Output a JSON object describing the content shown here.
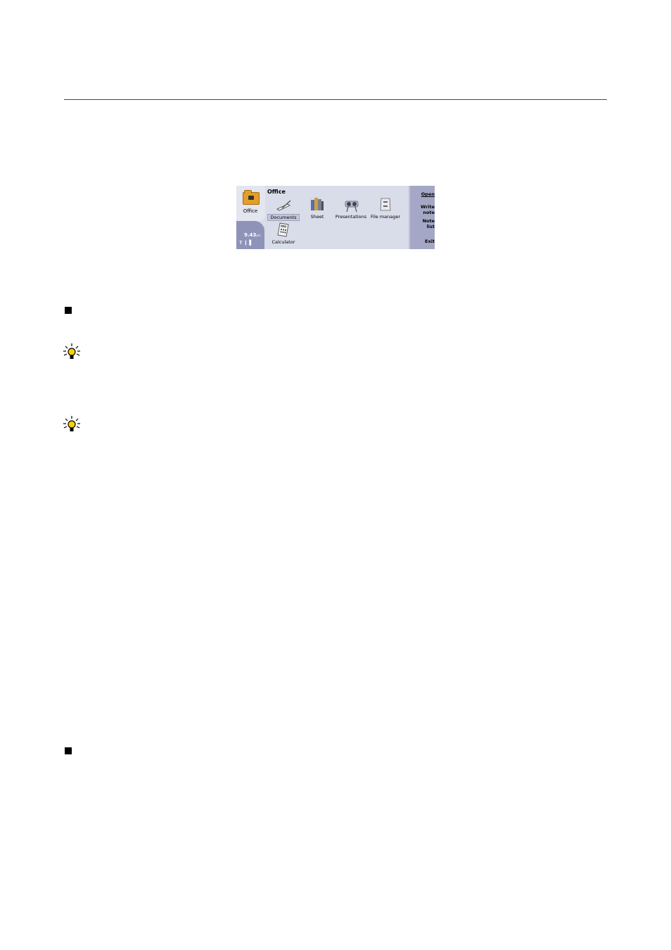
{
  "screen": {
    "tab_label": "Office",
    "clock": "9.43",
    "clock_suffix": "pm",
    "view_title": "Office",
    "apps": [
      {
        "label": "Documents",
        "icon": "documents-icon",
        "selected": true
      },
      {
        "label": "Sheet",
        "icon": "sheet-icon",
        "selected": false
      },
      {
        "label": "Presentations",
        "icon": "presentations-icon",
        "selected": false
      },
      {
        "label": "File manager",
        "icon": "file-manager-icon",
        "selected": false
      },
      {
        "label": "Calculator",
        "icon": "calculator-icon",
        "selected": false
      }
    ],
    "softkeys": {
      "open": "Open",
      "write_note": "Write note",
      "note_list": "Note list",
      "exit": "Exit"
    }
  },
  "colors": {
    "rule": "#1f4e9c",
    "screen_bg": "#d9dce9",
    "softkey_bg": "#a4a8c6",
    "status_bg": "#8f93b8"
  }
}
